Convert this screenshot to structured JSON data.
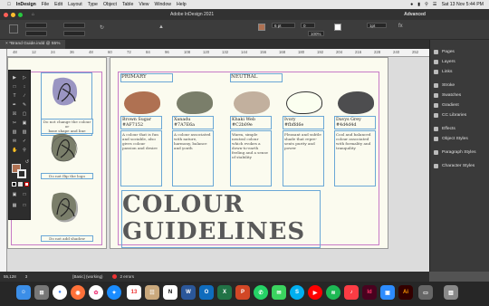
{
  "menubar": {
    "app_name": "InDesign",
    "items": [
      "File",
      "Edit",
      "Layout",
      "Type",
      "Object",
      "Table",
      "View",
      "Window",
      "Help"
    ],
    "clock": "Sat 13 Nov  5:44 PM"
  },
  "window": {
    "title": "Adobe InDesign 2021",
    "workspace": "Advanced"
  },
  "control": {
    "font_size": "6 pt",
    "tracking": "0",
    "zoom_pct": "100%",
    "stroke_width": "1pt",
    "x_field": "5,5",
    "y_field": "5,5"
  },
  "document": {
    "tab_label": "*Brand Guide.indd @ 55%"
  },
  "ruler": {
    "ticks": [
      "48",
      "12",
      "24",
      "36",
      "48",
      "60",
      "72",
      "84",
      "96",
      "108",
      "120",
      "132",
      "144",
      "156",
      "168",
      "180",
      "192",
      "204",
      "216",
      "228",
      "240",
      "252"
    ]
  },
  "left_page": {
    "logo_rules": [
      "Do not change the colour or\nbase shape and line",
      "Do not flip the logo",
      "Do not add shadow"
    ]
  },
  "right_page": {
    "section_primary": "PRIMARY",
    "section_neutral": "NEUTRAL",
    "swatches": [
      {
        "name": "Brown Sugar",
        "hex": "#AF7152",
        "color": "#af7152",
        "desc": "A colour that is fun and sociable, also gives colour passion and desire"
      },
      {
        "name": "Xanadu",
        "hex": "#7A7E6a",
        "color": "#7a7e6a",
        "desc": "A colour associated with nature, harmony, balance and youth"
      },
      {
        "name": "Khaki Web",
        "hex": "#C2b09e",
        "color": "#c2b09e",
        "desc": "Warm, simple neutral colour which evokes a down-to-earth feeling and a sense of stability"
      },
      {
        "name": "Ivory",
        "hex": "#fbffd6e",
        "color": "#fbfff0",
        "desc": "Pleasant and subtle shade that repre-sents purity and power"
      },
      {
        "name": "Davys Grey",
        "hex": "#4d4d4d",
        "color": "#4d4d4f",
        "desc": "Cool and balanced colour associated with formality and tranquility"
      }
    ],
    "heading_line1": "COLOUR",
    "heading_line2": "GUIDELINES"
  },
  "panels": {
    "items": [
      "Pages",
      "Layers",
      "Links",
      "Stroke",
      "Swatches",
      "Gradient",
      "CC Libraries",
      "Effects",
      "Object Styles",
      "Paragraph Styles",
      "Character Styles"
    ]
  },
  "status": {
    "zoom": "55,128",
    "page": "3",
    "style": "[Basic] (working)",
    "errors": "2 errors"
  },
  "dock": {
    "apps": [
      "Finder",
      "Launchpad",
      "Chrome",
      "Firefox",
      "Photos",
      "Safari",
      "Calendar",
      "Contacts",
      "Notion",
      "Word",
      "Outlook",
      "Excel",
      "PowerPoint",
      "WhatsApp",
      "Messages",
      "Skype",
      "YouTube",
      "Spotify",
      "Music",
      "InDesign",
      "Zoom",
      "Illustrator",
      "Preview",
      "Trash"
    ]
  }
}
